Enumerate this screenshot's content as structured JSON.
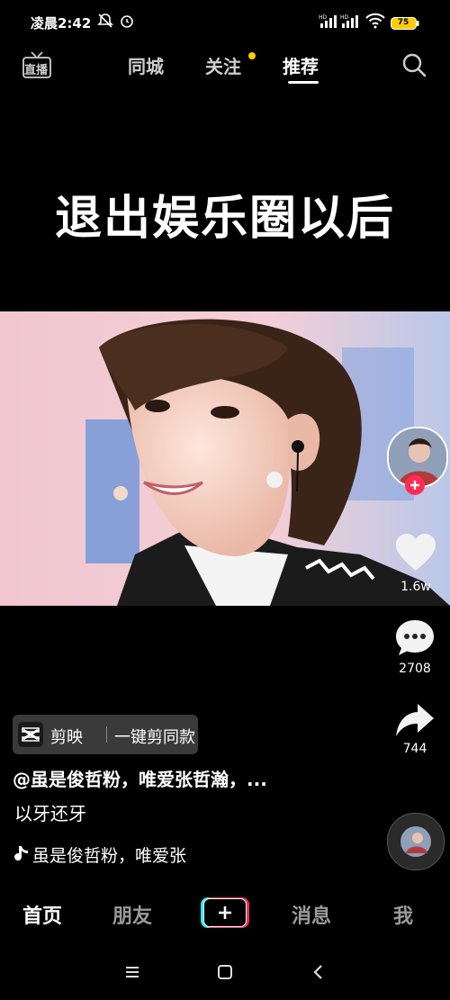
{
  "status_bar": {
    "time": "凌晨2:42",
    "battery": "75"
  },
  "top_nav": {
    "live_label": "直播",
    "tabs": [
      {
        "label": "同城"
      },
      {
        "label": "关注"
      },
      {
        "label": "推荐"
      }
    ]
  },
  "video": {
    "overlay_title": "退出娱乐圈以后"
  },
  "rail": {
    "like_count": "1.6w",
    "comment_count": "2708",
    "share_count": "744"
  },
  "info": {
    "capcut_app": "剪映",
    "capcut_action": "一键剪同款",
    "author": "@虽是俊哲粉，唯爱张哲瀚，...",
    "caption": "以牙还牙",
    "music": "虽是俊哲粉，唯爱张"
  },
  "bottom_nav": {
    "home": "首页",
    "friends": "朋友",
    "messages": "消息",
    "me": "我"
  },
  "colors": {
    "accent_red": "#fe2c55",
    "accent_cyan": "#25f4ee",
    "follow_dot": "#ffcc00",
    "battery": "#ffcc00"
  }
}
